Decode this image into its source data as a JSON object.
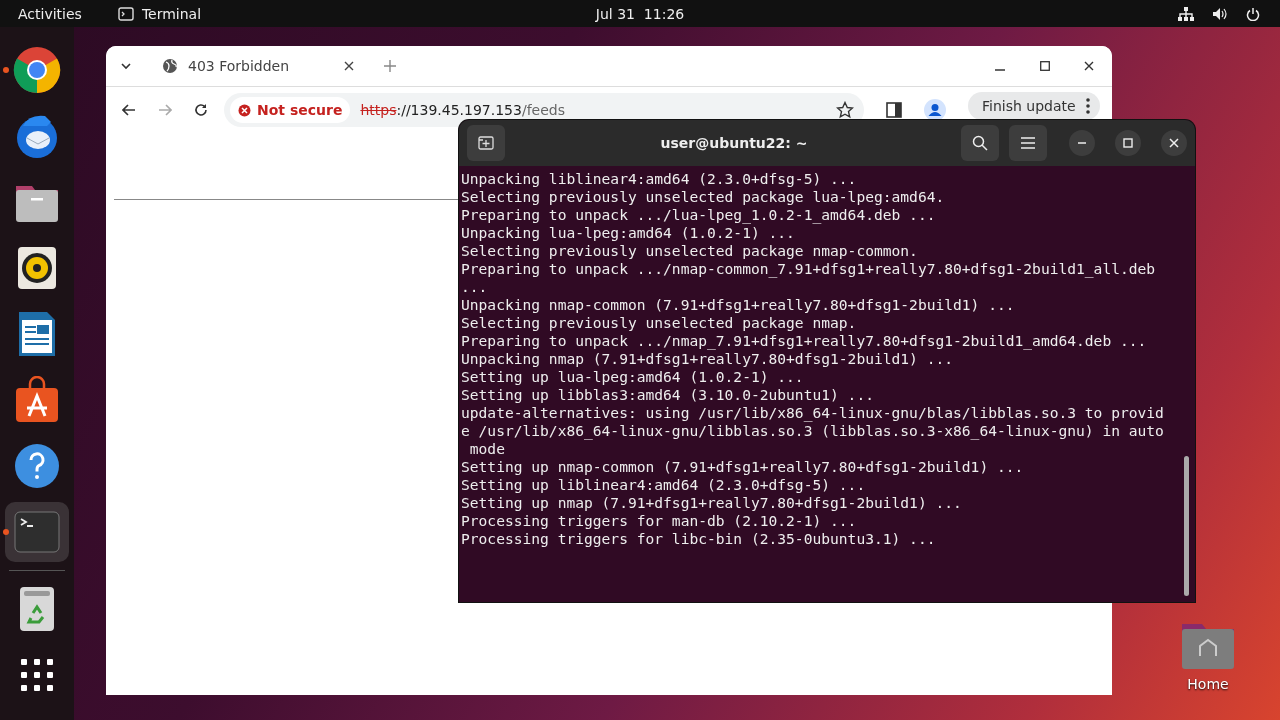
{
  "top_bar": {
    "activities": "Activities",
    "app_name": "Terminal",
    "clock": "Jul 31  11:26"
  },
  "dock": {
    "items": [
      {
        "running": true,
        "selected": false
      },
      {
        "running": false,
        "selected": false
      },
      {
        "running": false,
        "selected": false
      },
      {
        "running": false,
        "selected": false
      },
      {
        "running": false,
        "selected": false
      },
      {
        "running": false,
        "selected": false
      },
      {
        "running": false,
        "selected": false
      },
      {
        "running": true,
        "selected": true
      }
    ]
  },
  "browser": {
    "tab_title": "403 Forbidden",
    "security": "Not secure",
    "url_scheme": "https",
    "url_host": "://139.45.197.153",
    "url_path": "/feeds",
    "update_button": "Finish update"
  },
  "terminal": {
    "title": "user@ubuntu22: ~",
    "lines": [
      "Unpacking liblinear4:amd64 (2.3.0+dfsg-5) ...",
      "Selecting previously unselected package lua-lpeg:amd64.",
      "Preparing to unpack .../lua-lpeg_1.0.2-1_amd64.deb ...",
      "Unpacking lua-lpeg:amd64 (1.0.2-1) ...",
      "Selecting previously unselected package nmap-common.",
      "Preparing to unpack .../nmap-common_7.91+dfsg1+really7.80+dfsg1-2build1_all.deb",
      "...",
      "Unpacking nmap-common (7.91+dfsg1+really7.80+dfsg1-2build1) ...",
      "Selecting previously unselected package nmap.",
      "Preparing to unpack .../nmap_7.91+dfsg1+really7.80+dfsg1-2build1_amd64.deb ...",
      "Unpacking nmap (7.91+dfsg1+really7.80+dfsg1-2build1) ...",
      "Setting up lua-lpeg:amd64 (1.0.2-1) ...",
      "Setting up libblas3:amd64 (3.10.0-2ubuntu1) ...",
      "update-alternatives: using /usr/lib/x86_64-linux-gnu/blas/libblas.so.3 to provid",
      "e /usr/lib/x86_64-linux-gnu/libblas.so.3 (libblas.so.3-x86_64-linux-gnu) in auto",
      " mode",
      "Setting up nmap-common (7.91+dfsg1+really7.80+dfsg1-2build1) ...",
      "Setting up liblinear4:amd64 (2.3.0+dfsg-5) ...",
      "Setting up nmap (7.91+dfsg1+really7.80+dfsg1-2build1) ...",
      "Processing triggers for man-db (2.10.2-1) ...",
      "Processing triggers for libc-bin (2.35-0ubuntu3.1) ..."
    ]
  },
  "desktop_icons": [
    {
      "label": "Home"
    }
  ]
}
